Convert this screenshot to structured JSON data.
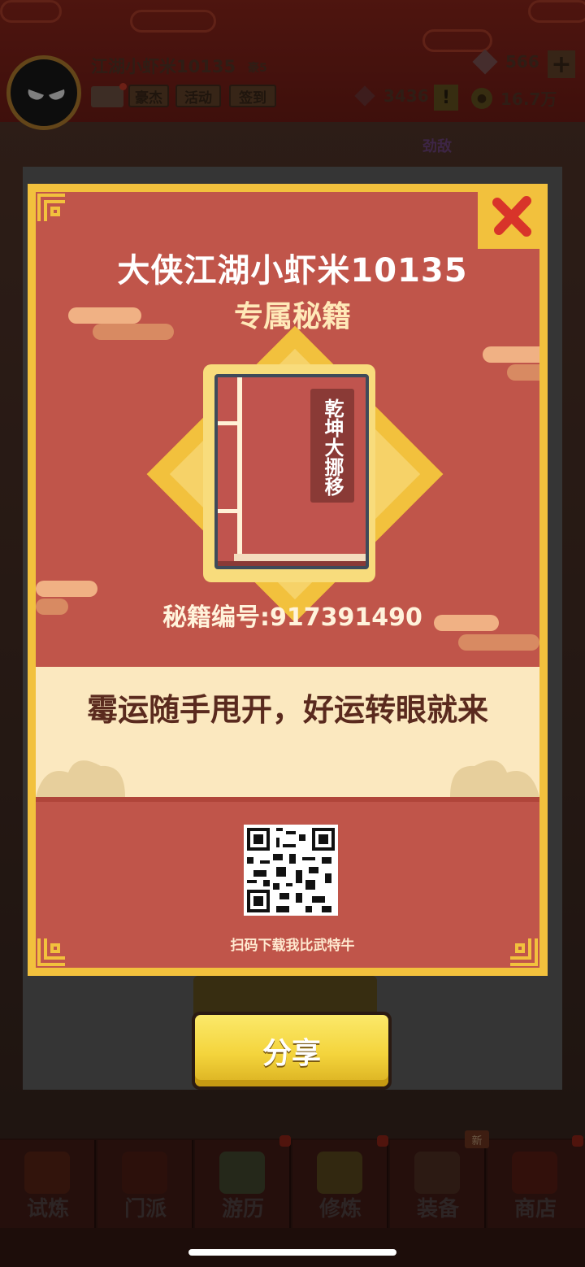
{
  "header": {
    "player_name": "江湖小虾米10135",
    "rank": "豪5",
    "buttons": [
      "豪杰",
      "活动",
      "签到"
    ],
    "gems": "566",
    "honor": "3436",
    "coins": "16.7万",
    "plus": "+",
    "warn": "!"
  },
  "background": {
    "enemy_tag": "劲敌",
    "share_behind": "分享"
  },
  "modal": {
    "title": "大侠江湖小虾米10135",
    "subtitle": "专属秘籍",
    "book_title": "乾坤大挪移",
    "serial": "秘籍编号:917391490",
    "quote": "霉运随手甩开，好运转眼就来",
    "qr_caption": "扫码下载我比武特牛",
    "share_label": "分享"
  },
  "nav": {
    "items": [
      {
        "label": "试炼",
        "icon": "scroll-icon"
      },
      {
        "label": "门派",
        "icon": "temple-icon"
      },
      {
        "label": "游历",
        "icon": "mountain-icon"
      },
      {
        "label": "修炼",
        "icon": "books-icon"
      },
      {
        "label": "装备",
        "icon": "sword-icon"
      },
      {
        "label": "商店",
        "icon": "shop-icon"
      }
    ],
    "new_badge": "新"
  },
  "colors": {
    "card_border": "#f2c13d",
    "card_fill": "#c0554a",
    "band": "#fbe8bf"
  }
}
